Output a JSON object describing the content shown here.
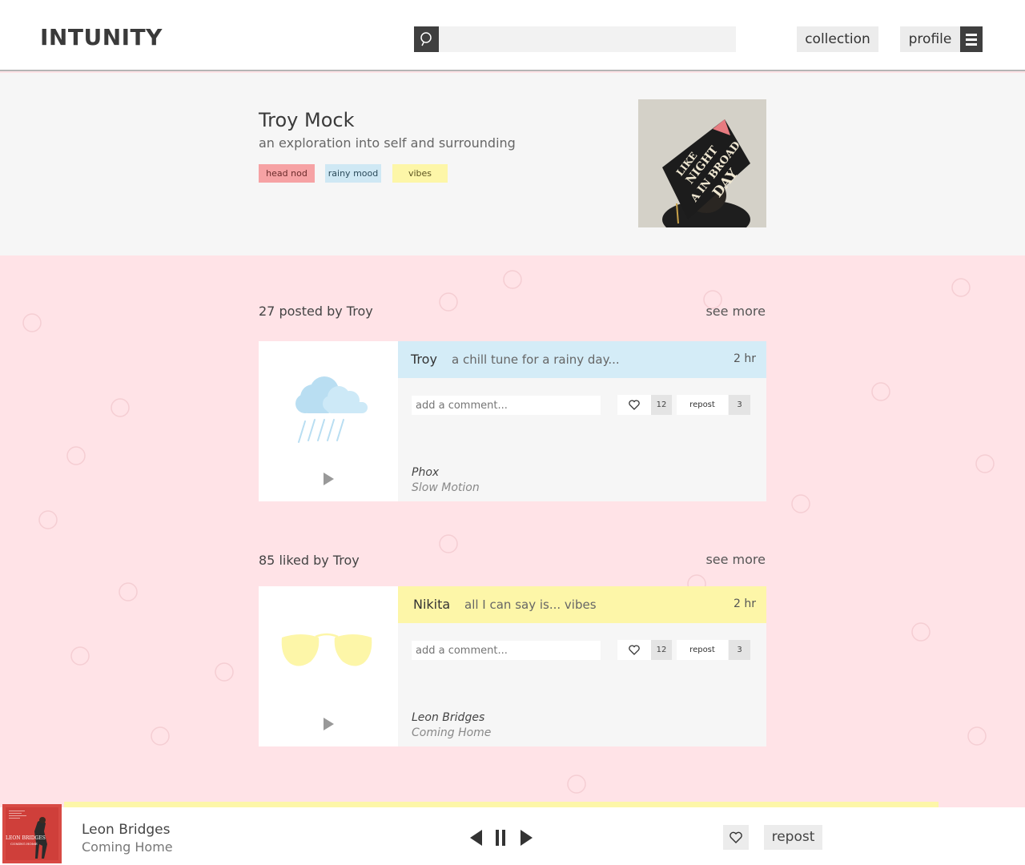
{
  "header": {
    "logo": "INTUNITY",
    "search": {
      "value": "",
      "placeholder": ""
    },
    "nav": {
      "collection": "collection",
      "profile": "profile"
    },
    "icons": {
      "search": "search-icon",
      "menu": "hamburger-menu-icon"
    }
  },
  "profile": {
    "name": "Troy Mock",
    "subtitle": "an exploration into self and surrounding",
    "tags": [
      {
        "label": "head nod",
        "color": "#f6a2a4"
      },
      {
        "label": "rainy mood",
        "color": "#cfe8f4"
      },
      {
        "label": "vibes",
        "color": "#fdf6a8"
      }
    ],
    "photo_text": [
      "LIKE",
      "NIGHT",
      "A",
      "IN BROAD",
      "DAY"
    ]
  },
  "sections": [
    {
      "title": "27 posted by Troy",
      "see_more": "see more",
      "post": {
        "user": "Troy",
        "caption": "a chill tune for a rainy day...",
        "time": "2 hr",
        "head_color": "#d4ecf7",
        "art_icon": "rain-cloud-icon",
        "comment_placeholder": "add a comment...",
        "likes": "12",
        "repost_label": "repost",
        "reposts": "3",
        "artist": "Phox",
        "track": "Slow Motion"
      }
    },
    {
      "title": "85 liked by Troy",
      "see_more": "see more",
      "post": {
        "user": "Nikita",
        "caption": "all I can say is... vibes",
        "time": "2 hr",
        "head_color": "#fdf6a8",
        "art_icon": "sunglasses-icon",
        "comment_placeholder": "add a comment...",
        "likes": "12",
        "repost_label": "repost",
        "reposts": "3",
        "artist": "Leon Bridges",
        "track": "Coming Home"
      }
    }
  ],
  "player": {
    "artist": "Leon Bridges",
    "track": "Coming Home",
    "album_text": [
      "LEON BRIDGES",
      "COMING HOME"
    ],
    "progress": 0.92,
    "repost_label": "repost",
    "progress_color": "#fdf6a8"
  }
}
